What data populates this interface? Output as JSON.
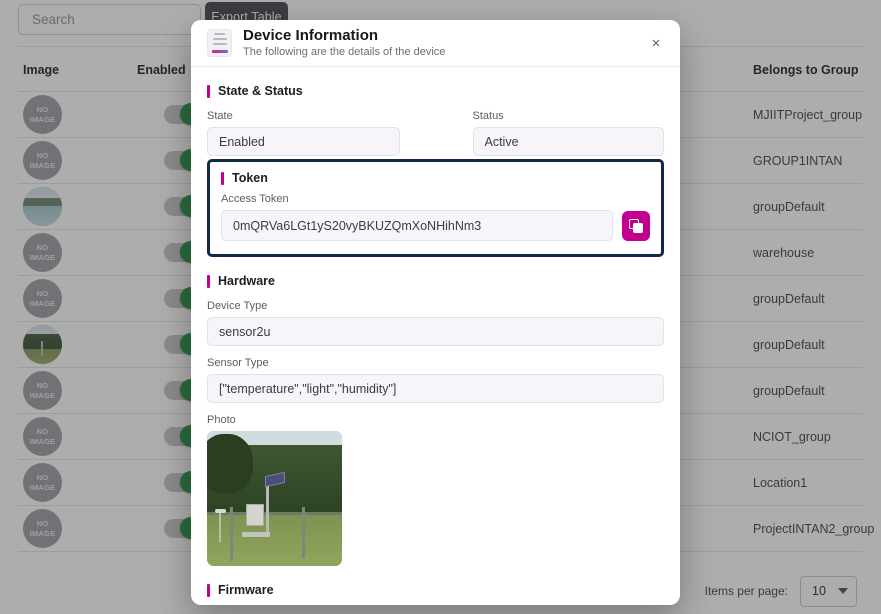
{
  "background": {
    "search": {
      "placeholder": "Search",
      "value": ""
    },
    "export_button": "Export Table",
    "table": {
      "columns": [
        "Image",
        "Enabled",
        "Belongs to Group"
      ],
      "rows": [
        {
          "image": "NO IMAGE",
          "enabled": true,
          "group": "MJIITProject_group"
        },
        {
          "image": "NO IMAGE",
          "enabled": true,
          "group": "GROUP1INTAN"
        },
        {
          "image": "photo",
          "enabled": true,
          "group": "groupDefault"
        },
        {
          "image": "NO IMAGE",
          "enabled": true,
          "group": "warehouse"
        },
        {
          "image": "NO IMAGE",
          "enabled": true,
          "group": "groupDefault"
        },
        {
          "image": "photo",
          "enabled": true,
          "group": "groupDefault"
        },
        {
          "image": "NO IMAGE",
          "enabled": true,
          "group": "groupDefault"
        },
        {
          "image": "NO IMAGE",
          "enabled": true,
          "group": "NCIOT_group"
        },
        {
          "image": "NO IMAGE",
          "enabled": true,
          "group": "Location1"
        },
        {
          "image": "NO IMAGE",
          "enabled": true,
          "group": "ProjectINTAN2_group"
        }
      ]
    },
    "paginator": {
      "label": "Items per page:",
      "value": "10"
    }
  },
  "dialog": {
    "title": "Device Information",
    "subtitle": "The following are the details of the device",
    "close_label": "×",
    "sections": {
      "state_status": {
        "heading": "State & Status",
        "state_label": "State",
        "state_value": "Enabled",
        "status_label": "Status",
        "status_value": "Active"
      },
      "token": {
        "heading": "Token",
        "access_token_label": "Access Token",
        "access_token_value": "0mQRVa6LGt1yS20vyBKUZQmXoNHihNm3",
        "copy_button": "copy"
      },
      "hardware": {
        "heading": "Hardware",
        "device_type_label": "Device Type",
        "device_type_value": "sensor2u",
        "sensor_type_label": "Sensor Type",
        "sensor_type_value": "[\"temperature\",\"light\",\"humidity\"]",
        "photo_label": "Photo"
      },
      "firmware": {
        "heading": "Firmware"
      }
    }
  },
  "colors": {
    "accent": "#c2008f",
    "highlight_border": "#12294b",
    "toggle_on": "#1e8e3e",
    "export_button_bg": "#3f3f46"
  }
}
